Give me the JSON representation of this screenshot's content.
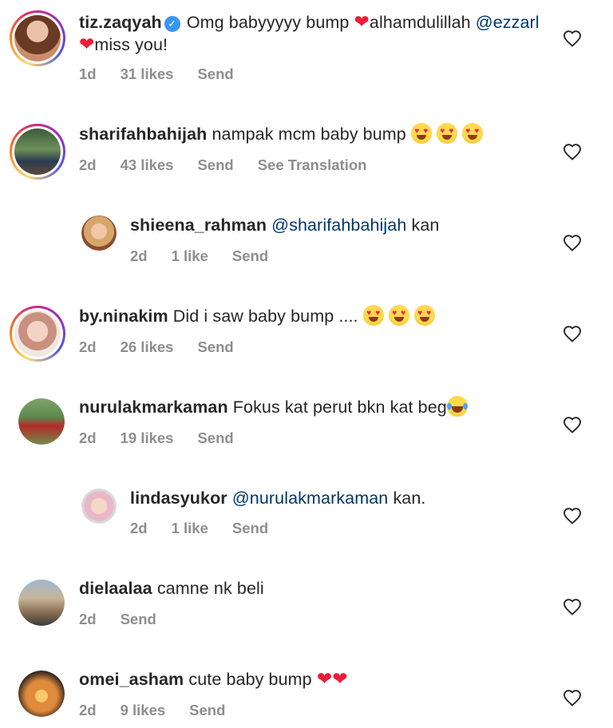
{
  "colors": {
    "username": "#262626",
    "mention": "#00376b",
    "meta": "#8e8e8e",
    "heart": "#ed1c3a",
    "verified": "#3897f0"
  },
  "comments": [
    {
      "username": "tiz.zaqyah",
      "verified": true,
      "text_parts": [
        "Omg babyyyyy bump",
        "alhamdulillah",
        "@ezzarl",
        "miss you!"
      ],
      "meta": [
        "1d",
        "31 likes",
        "Send"
      ],
      "story_ring": true
    },
    {
      "username": "sharifahbahijah",
      "text": "nampak mcm baby bump",
      "meta": [
        "2d",
        "43 likes",
        "Send",
        "See Translation"
      ],
      "story_ring": true
    },
    {
      "username": "shieena_rahman",
      "mention": "@sharifahbahijah",
      "text": "kan",
      "meta": [
        "2d",
        "1 like",
        "Send"
      ],
      "reply": true
    },
    {
      "username": "by.ninakim",
      "text": "Did i saw baby bump ....",
      "meta": [
        "2d",
        "26 likes",
        "Send"
      ],
      "story_ring": true
    },
    {
      "username": "nurulakmarkaman",
      "text": "Fokus kat perut bkn kat beg",
      "meta": [
        "2d",
        "19 likes",
        "Send"
      ]
    },
    {
      "username": "lindasyukor",
      "mention": "@nurulakmarkaman",
      "text": "kan.",
      "meta": [
        "2d",
        "1 like",
        "Send"
      ],
      "reply": true
    },
    {
      "username": "dielaalaa",
      "text": "camne nk beli",
      "meta": [
        "2d",
        "Send"
      ]
    },
    {
      "username": "omei_asham",
      "text": "cute baby bump",
      "meta": [
        "2d",
        "9 likes",
        "Send"
      ]
    }
  ]
}
